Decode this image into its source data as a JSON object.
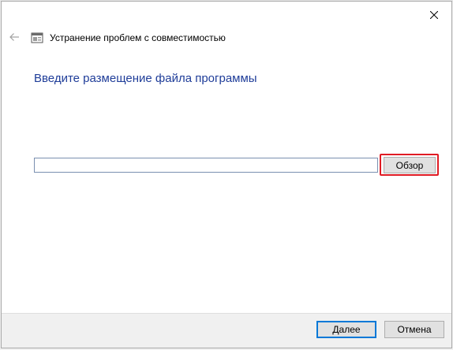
{
  "window": {
    "title": "Устранение проблем с совместимостью",
    "close_icon": "close-icon",
    "back_icon": "back-arrow-icon",
    "app_icon": "troubleshooter-icon"
  },
  "main": {
    "heading": "Введите размещение файла программы",
    "path_input": {
      "value": "",
      "placeholder": ""
    },
    "browse_label": "Обзор",
    "highlight_color": "#e01b24"
  },
  "footer": {
    "next_label": "Далее",
    "cancel_label": "Отмена"
  },
  "colors": {
    "heading": "#1f3d99",
    "accent": "#0078d7"
  }
}
